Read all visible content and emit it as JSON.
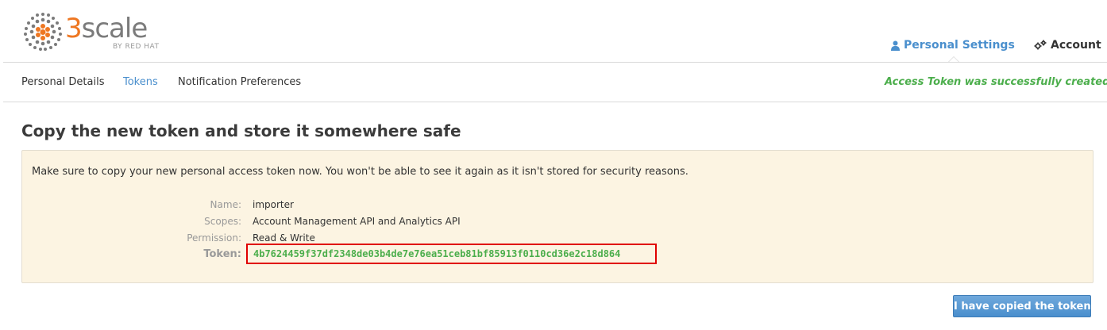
{
  "brand": {
    "logo_text_prefix": "3",
    "logo_text_rest": "scale",
    "logo_subtext": "BY RED HAT",
    "orange": "#ee7722",
    "grey": "#7b7b7b"
  },
  "topnav": {
    "personal_settings": {
      "label": "Personal Settings",
      "icon": "user-icon"
    },
    "account": {
      "label": "Account",
      "icon": "gears-icon"
    }
  },
  "subnav": {
    "items": [
      {
        "label": "Personal Details",
        "active": false
      },
      {
        "label": "Tokens",
        "active": true
      },
      {
        "label": "Notification Preferences",
        "active": false
      }
    ],
    "flash_message": "Access Token was successfully created"
  },
  "main": {
    "title": "Copy the new token and store it somewhere safe",
    "notice": "Make sure to copy your new personal access token now. You won't be able to see it again as it isn't stored for security reasons.",
    "details": [
      {
        "key": "Name:",
        "value": "importer"
      },
      {
        "key": "Scopes:",
        "value": "Account Management API and Analytics API"
      },
      {
        "key": "Permission:",
        "value": "Read & Write"
      }
    ],
    "token_label": "Token:",
    "token_value": "4b7624459f37df2348de03b4de7e76ea51ceb81bf85913f0110cd36e2c18d864",
    "confirm_button": "I have copied the token"
  },
  "colors": {
    "link_blue": "#4a8fcd",
    "success_green": "#4cae4c",
    "notice_bg": "#fcf4e2",
    "highlight_red": "#e00000"
  }
}
